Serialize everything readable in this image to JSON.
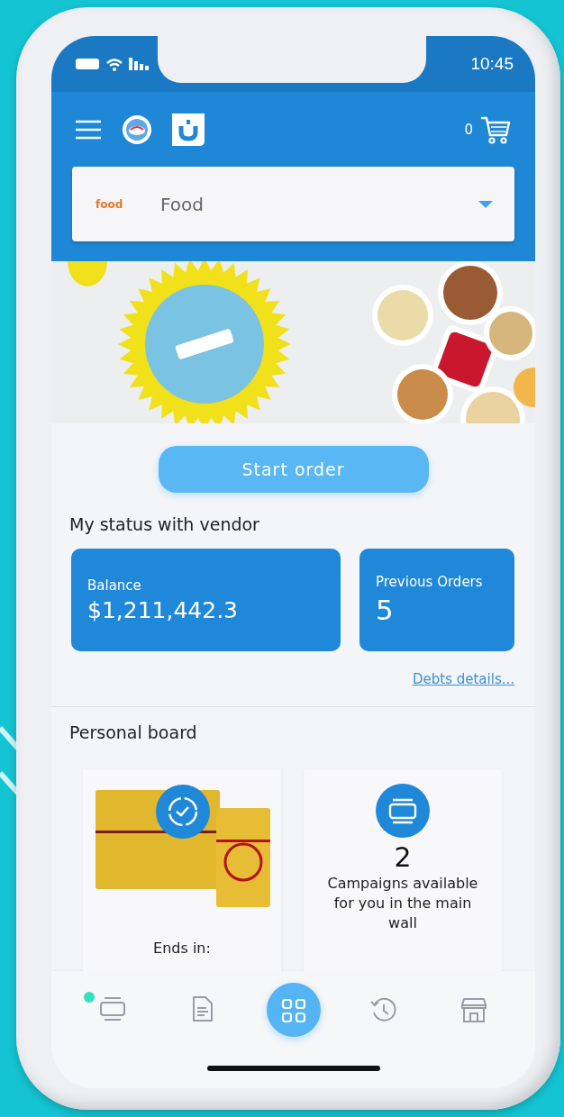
{
  "status_bar": {
    "time": "10:45"
  },
  "header": {
    "cart_count": "0"
  },
  "category_dropdown": {
    "logo_text": "food",
    "value": "Food"
  },
  "start_button": {
    "label": "Start order"
  },
  "vendor_status": {
    "title": "My status with vendor",
    "cards": [
      {
        "label": "Balance",
        "value": "$1,211,442.3"
      },
      {
        "label": "Previous Orders",
        "value": "5"
      }
    ],
    "link": "Debts details..."
  },
  "personal_board": {
    "title": "Personal board",
    "cards": [
      {
        "kind": "product",
        "text": "Ends in:"
      },
      {
        "kind": "campaigns",
        "count": "2",
        "text": "Campaigns available for you in the main wall"
      }
    ]
  },
  "bottom_nav": [
    {
      "selected": false,
      "notification": true
    },
    {
      "selected": false,
      "notification": false
    },
    {
      "selected": true,
      "notification": false
    },
    {
      "selected": false,
      "notification": false
    },
    {
      "selected": false,
      "notification": false
    }
  ]
}
